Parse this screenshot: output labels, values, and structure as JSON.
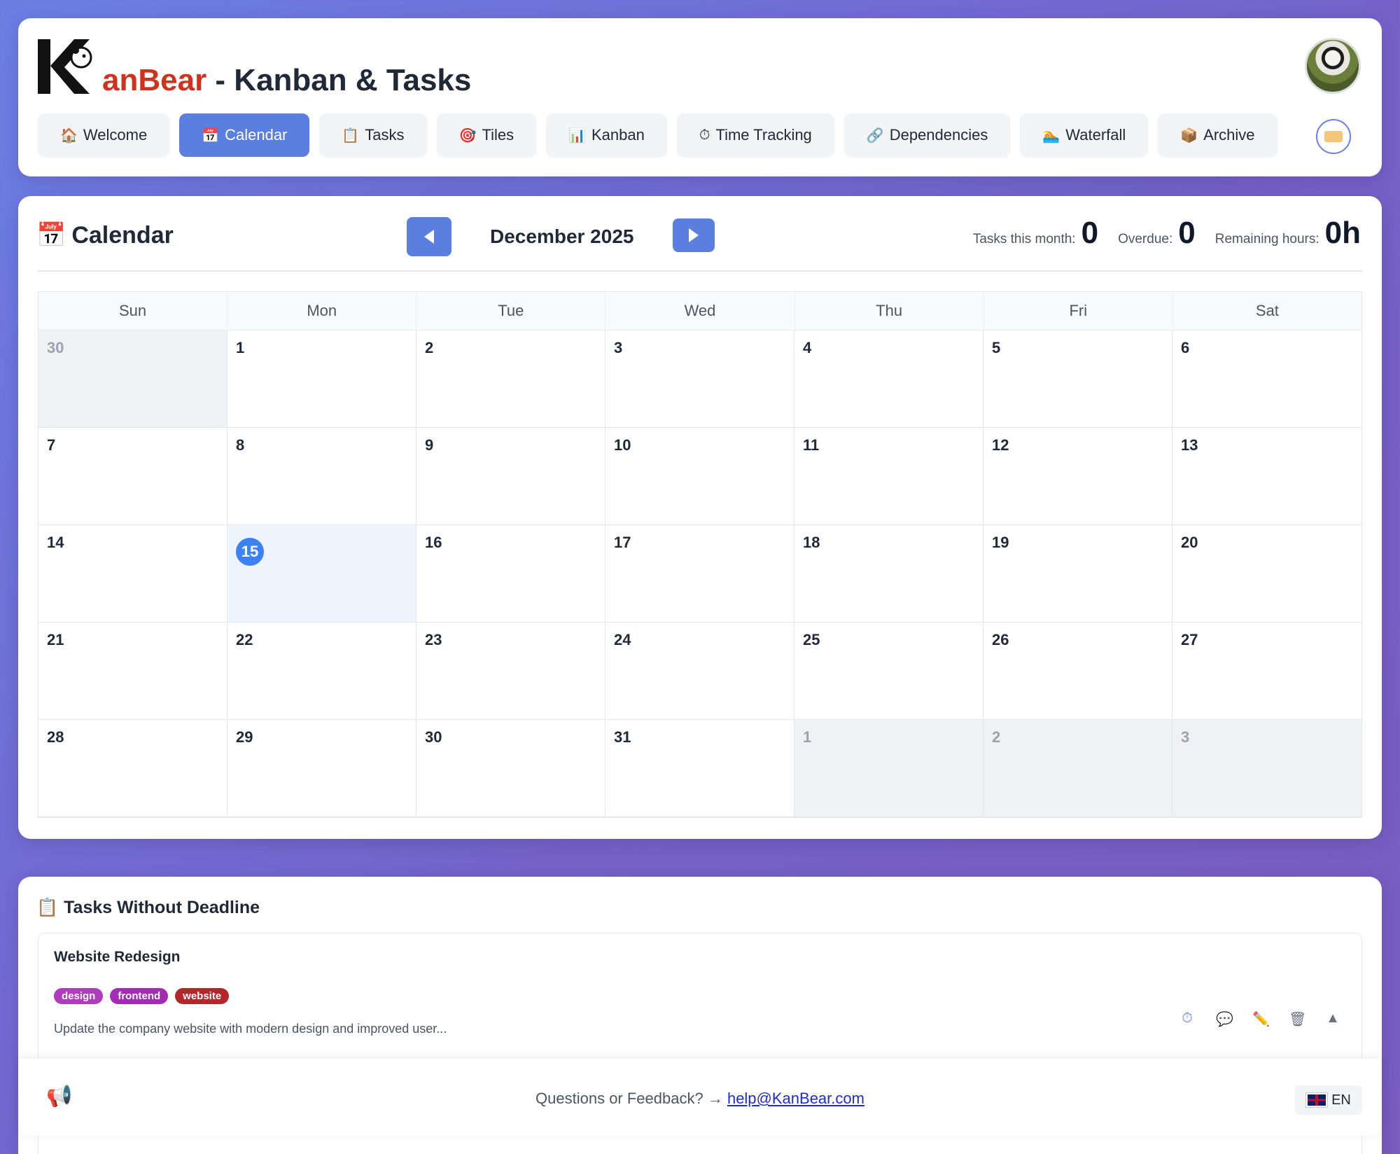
{
  "header": {
    "brand": "anBear",
    "title_suffix": " - Kanban & Tasks",
    "tabs": [
      {
        "label": "Welcome",
        "icon": "🏠"
      },
      {
        "label": "Calendar",
        "icon": "📅",
        "active": true
      },
      {
        "label": "Tasks",
        "icon": "📋"
      },
      {
        "label": "Tiles",
        "icon": "🎯"
      },
      {
        "label": "Kanban",
        "icon": "📊"
      },
      {
        "label": "Time Tracking",
        "icon": "⏱"
      },
      {
        "label": "Dependencies",
        "icon": "🔗"
      },
      {
        "label": "Waterfall",
        "icon": "🏊"
      },
      {
        "label": "Archive",
        "icon": "📦"
      }
    ]
  },
  "calendar": {
    "title": "Calendar",
    "month": "December 2025",
    "stats": {
      "tasks_label": "Tasks this month:",
      "tasks_value": "0",
      "overdue_label": "Overdue:",
      "overdue_value": "0",
      "remaining_label": "Remaining hours:",
      "remaining_value": "0h"
    },
    "weekdays": [
      "Sun",
      "Mon",
      "Tue",
      "Wed",
      "Thu",
      "Fri",
      "Sat"
    ],
    "days": [
      {
        "d": "30",
        "other": true
      },
      {
        "d": "1"
      },
      {
        "d": "2"
      },
      {
        "d": "3"
      },
      {
        "d": "4"
      },
      {
        "d": "5"
      },
      {
        "d": "6"
      },
      {
        "d": "7"
      },
      {
        "d": "8"
      },
      {
        "d": "9"
      },
      {
        "d": "10"
      },
      {
        "d": "11"
      },
      {
        "d": "12"
      },
      {
        "d": "13"
      },
      {
        "d": "14"
      },
      {
        "d": "15",
        "today": true
      },
      {
        "d": "16"
      },
      {
        "d": "17"
      },
      {
        "d": "18"
      },
      {
        "d": "19"
      },
      {
        "d": "20"
      },
      {
        "d": "21"
      },
      {
        "d": "22"
      },
      {
        "d": "23"
      },
      {
        "d": "24"
      },
      {
        "d": "25"
      },
      {
        "d": "26"
      },
      {
        "d": "27"
      },
      {
        "d": "28"
      },
      {
        "d": "29"
      },
      {
        "d": "30"
      },
      {
        "d": "31"
      },
      {
        "d": "1",
        "other": true
      },
      {
        "d": "2",
        "other": true
      },
      {
        "d": "3",
        "other": true
      }
    ]
  },
  "no_deadline": {
    "title": "Tasks Without Deadline",
    "tasks": [
      {
        "name": "Website Redesign",
        "tags": [
          {
            "label": "design",
            "color": "#b03bbd"
          },
          {
            "label": "frontend",
            "color": "#a42bb6"
          },
          {
            "label": "website",
            "color": "#b3262b"
          }
        ],
        "description": "Update the company website with modern design and improved user..."
      }
    ]
  },
  "footer": {
    "question": "Questions or Feedback? → ",
    "email": "help@KanBear.com",
    "lang": "EN"
  }
}
